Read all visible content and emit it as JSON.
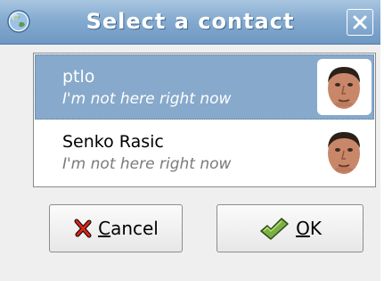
{
  "window": {
    "title": "Select a contact",
    "icon": "globe-icon",
    "close_icon": "close-icon"
  },
  "contacts": [
    {
      "name": "ptlo",
      "status": "I'm not here right now",
      "selected": true,
      "avatar": "face-avatar"
    },
    {
      "name": "Senko Rasic",
      "status": "I'm not here right now",
      "selected": false,
      "avatar": "face-avatar"
    }
  ],
  "buttons": {
    "cancel": {
      "mnemonic": "C",
      "rest": "ancel",
      "icon": "red-x-icon"
    },
    "ok": {
      "mnemonic": "O",
      "rest": "K",
      "icon": "green-checkmark-icon"
    }
  },
  "colors": {
    "titlebar": "#85abd0",
    "selection": "#87a9cb",
    "status_gray": "#7a7a7a"
  }
}
